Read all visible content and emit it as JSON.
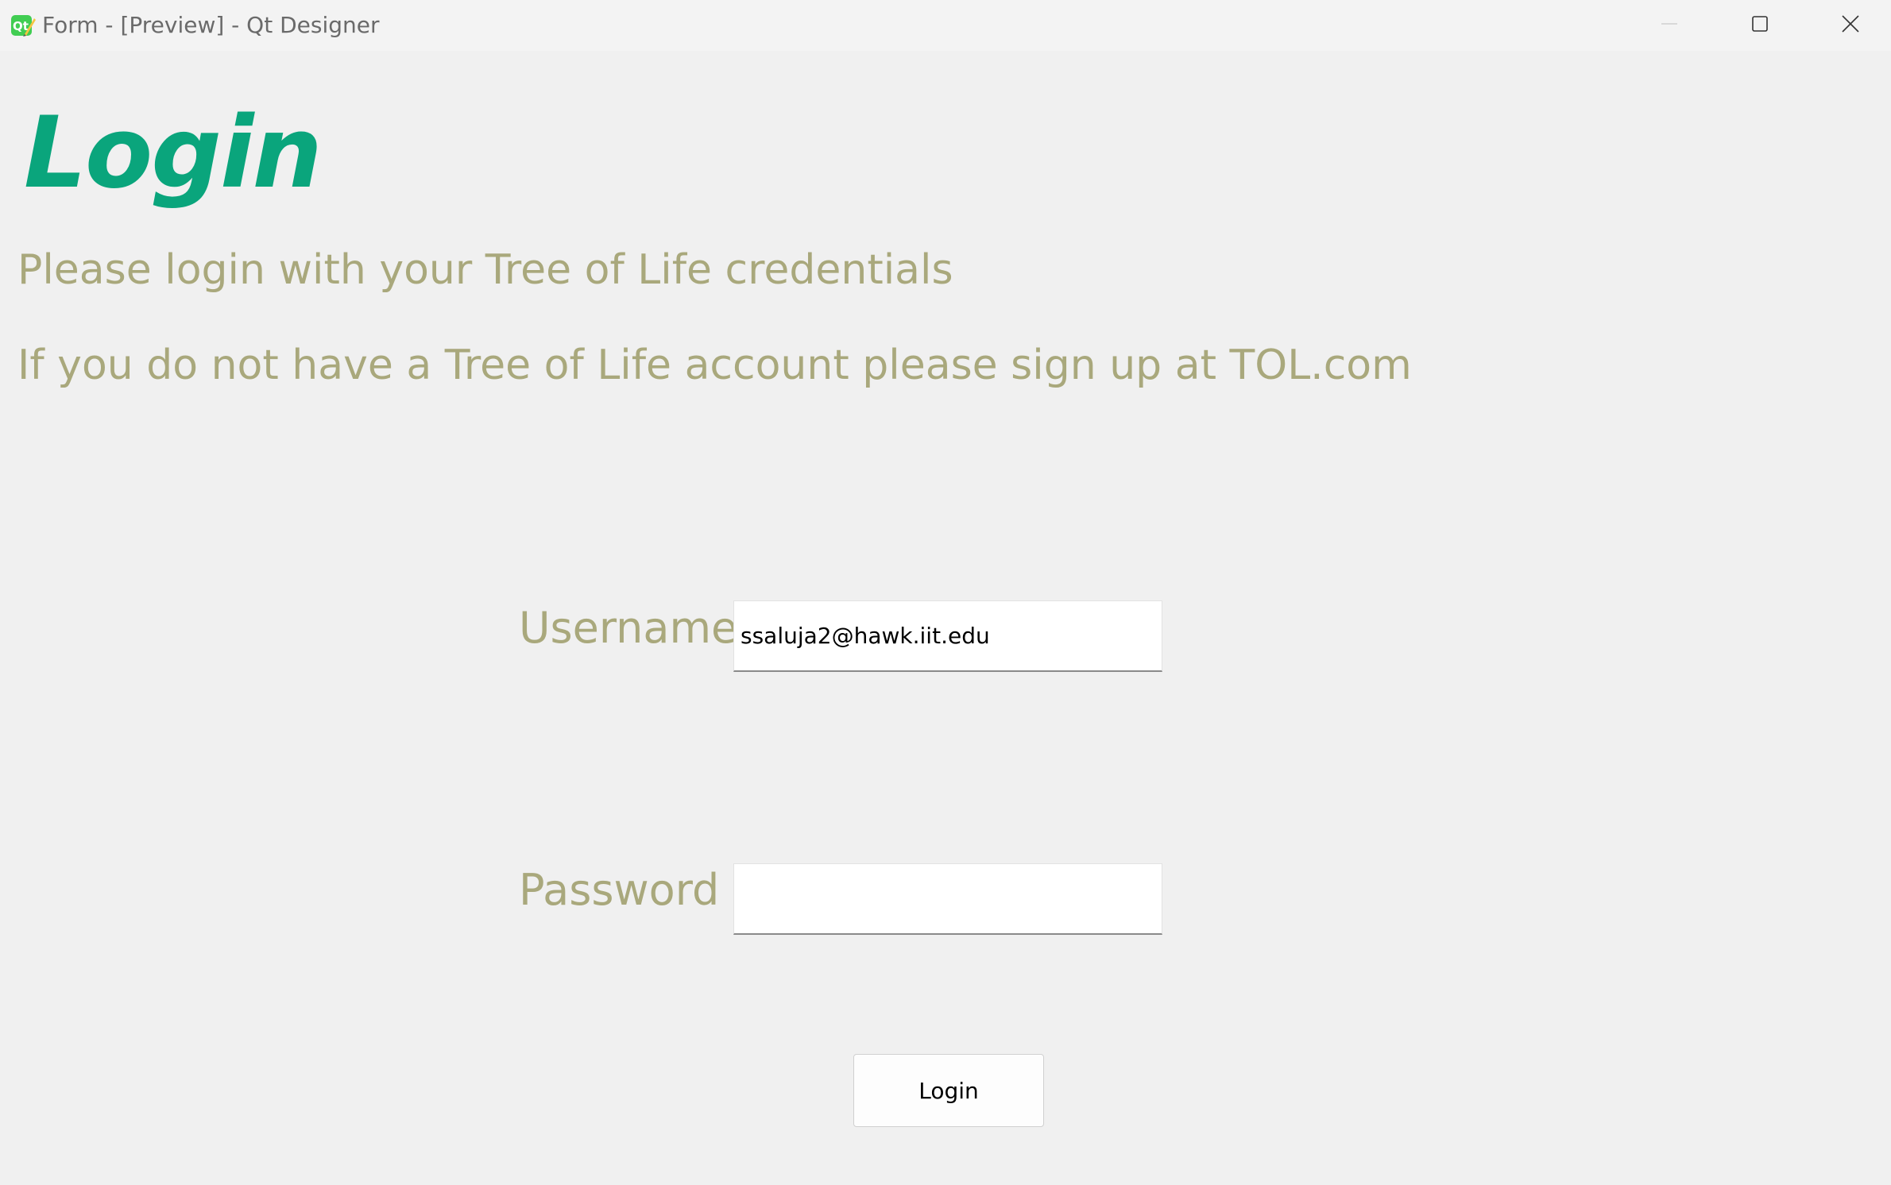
{
  "window": {
    "title": "Form - [Preview] - Qt Designer",
    "app_icon": "qt-designer-icon",
    "controls": [
      "minimize-icon",
      "maximize-icon",
      "close-icon"
    ]
  },
  "form": {
    "heading": "Login",
    "info_line_1": "Please login with your Tree of Life credentials",
    "info_line_2": "If you do not have a Tree of Life account please sign up at TOL.com",
    "username_label": "Username",
    "username_value": "ssaluja2@hawk.iit.edu",
    "password_label": "Password",
    "password_value": "",
    "login_button_label": "Login"
  },
  "colors": {
    "heading": "#0aa57c",
    "label_text": "#a9a87c",
    "background": "#f0f0f0"
  }
}
